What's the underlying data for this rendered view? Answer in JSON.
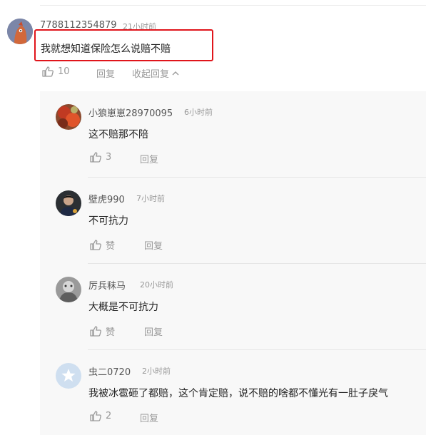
{
  "main": {
    "username": "7788112354879",
    "time": "21小时前",
    "text": "我就想知道保险怎么说赔不赔",
    "like_count": "10",
    "reply_label": "回复",
    "collapse_label": "收起回复",
    "collapse_icon": "chevron-up-icon"
  },
  "replies": [
    {
      "username": "小狼崽崽28970095",
      "time": "6小时前",
      "text": "这不赔那不陪",
      "like": "3",
      "reply_label": "回复"
    },
    {
      "username": "壁虎990",
      "time": "7小时前",
      "text": "不可抗力",
      "like": "赞",
      "reply_label": "回复"
    },
    {
      "username": "厉兵秣马",
      "time": "20小时前",
      "text": "大概是不可抗力",
      "like": "赞",
      "reply_label": "回复"
    },
    {
      "username": "虫二0720",
      "time": "2小时前",
      "text": "我被冰雹砸了都赔，这个肯定赔，说不赔的啥都不懂光有一肚子戾气",
      "like": "2",
      "reply_label": "回复"
    }
  ],
  "colors": {
    "highlight": "#e0151b",
    "reply_bg": "#f8f8f8",
    "muted": "#999999"
  }
}
